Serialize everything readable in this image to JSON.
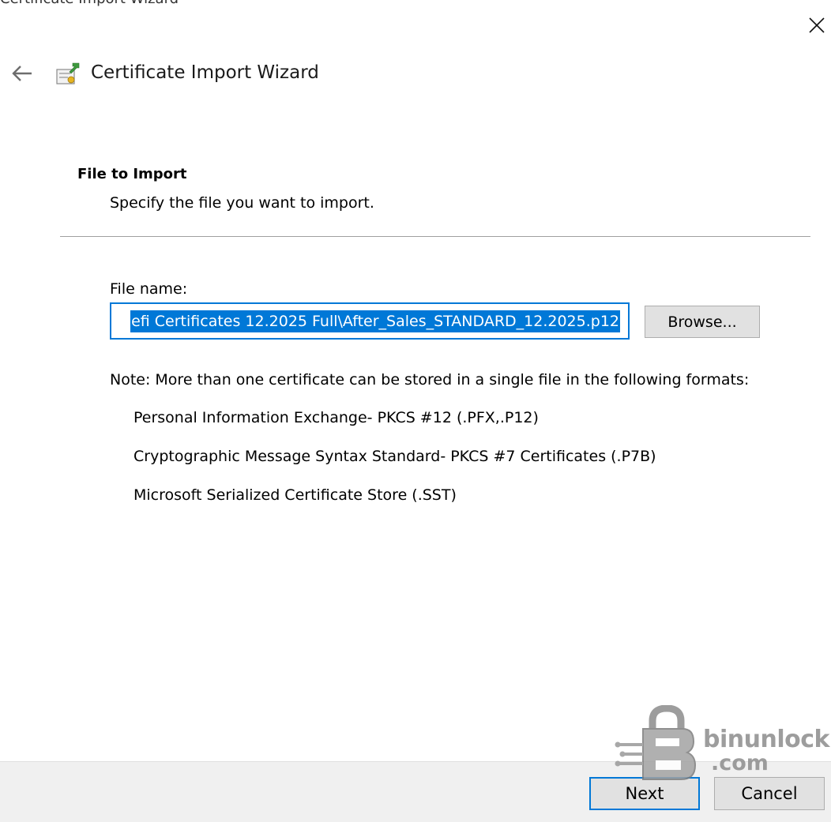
{
  "window": {
    "clipped_title": "Certificate Import Wizard"
  },
  "header": {
    "title": "Certificate Import Wizard"
  },
  "section": {
    "heading": "File to Import",
    "subtitle": "Specify the file you want to import."
  },
  "file": {
    "label": "File name:",
    "value": "efi Certificates 12.2025 Full\\After_Sales_STANDARD_12.2025.p12",
    "browse_label": "Browse..."
  },
  "note": {
    "text": "Note:  More than one certificate can be stored in a single file in the following formats:",
    "formats": [
      "Personal Information Exchange- PKCS #12 (.PFX,.P12)",
      "Cryptographic Message Syntax Standard- PKCS #7 Certificates (.P7B)",
      "Microsoft Serialized Certificate Store (.SST)"
    ]
  },
  "footer": {
    "next_label": "Next",
    "cancel_label": "Cancel"
  },
  "watermark": {
    "line1": "binunlock",
    "line2": ".com"
  },
  "colors": {
    "accent": "#0078d7",
    "button_bg": "#e1e1e1",
    "footer_bg": "#f0f0f0",
    "divider": "#a0a0a0"
  },
  "icons": {
    "close": "close-icon",
    "back": "back-arrow-icon",
    "wizard": "certificate-wizard-icon"
  }
}
